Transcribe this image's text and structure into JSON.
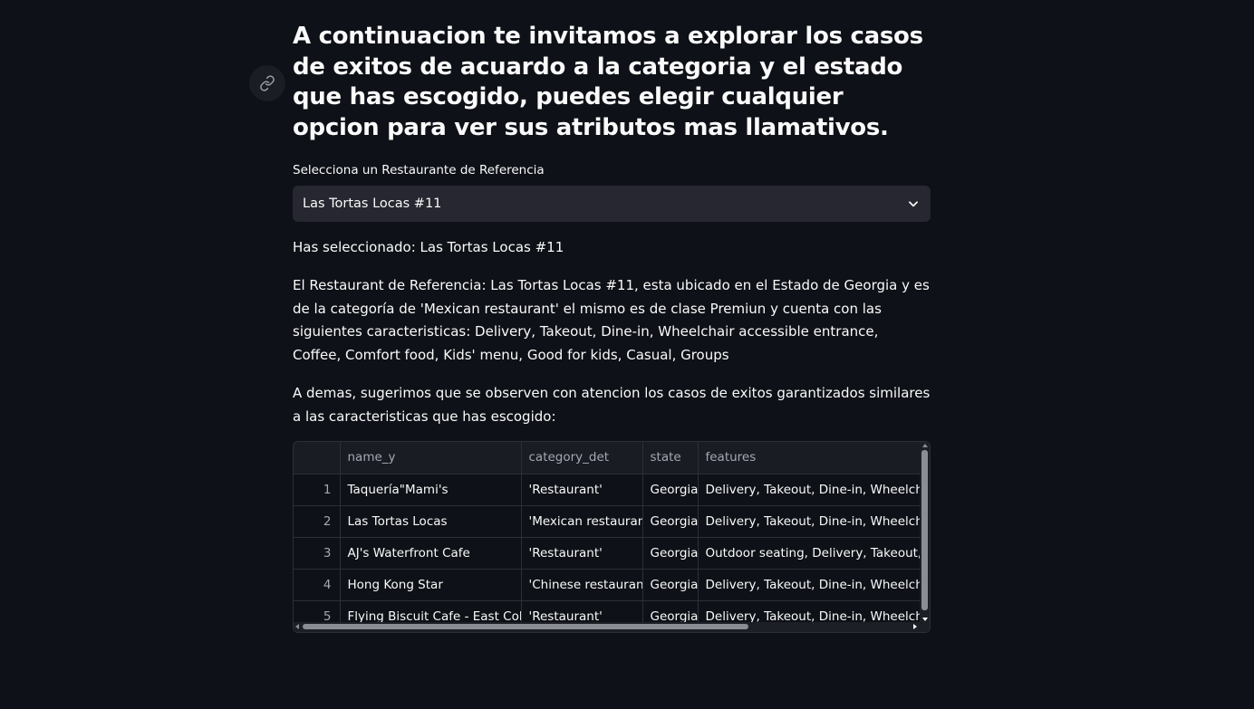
{
  "heading": "A continuacion te invitamos a explorar los casos de exitos de acuardo a la categoria y el estado que has escogido, puedes elegir cualquier opcion para ver sus atributos mas llamativos.",
  "select": {
    "label": "Selecciona un Restaurante de Referencia",
    "value": "Las Tortas Locas #11"
  },
  "selected_text": "Has seleccionado: Las Tortas Locas #11",
  "description": "El Restaurant de Referencia: Las Tortas Locas #11, esta ubicado en el Estado de Georgia y es de la categoría de 'Mexican restaurant' el mismo es de clase Premiun y cuenta con las siguientes caracteristicas: Delivery, Takeout, Dine-in, Wheelchair accessible entrance, Coffee, Comfort food, Kids' menu, Good for kids, Casual, Groups",
  "suggestion": "A demas, sugerimos que se observen con atencion los casos de exitos garantizados similares a las caracteristicas que has escogido:",
  "table": {
    "columns": [
      "",
      "name_y",
      "category_det",
      "state",
      "features"
    ],
    "rows": [
      {
        "index": "1",
        "name_y": "Taquería\"Mami's",
        "category_det": "'Restaurant'",
        "state": "Georgia",
        "features": "Delivery, Takeout, Dine-in, Wheelchair ac"
      },
      {
        "index": "2",
        "name_y": "Las Tortas Locas",
        "category_det": "'Mexican restaurant'",
        "state": "Georgia",
        "features": "Delivery, Takeout, Dine-in, Wheelchair ac"
      },
      {
        "index": "3",
        "name_y": "AJ's Waterfront Cafe",
        "category_det": "'Restaurant'",
        "state": "Georgia",
        "features": "Outdoor seating, Delivery, Takeout, Whee"
      },
      {
        "index": "4",
        "name_y": "Hong Kong Star",
        "category_det": "'Chinese restaurant'",
        "state": "Georgia",
        "features": "Delivery, Takeout, Dine-in, Wheelchair ac"
      },
      {
        "index": "5",
        "name_y": "Flying Biscuit Cafe - East Cobb",
        "category_det": "'Restaurant'",
        "state": "Georgia",
        "features": "Delivery, Takeout, Dine-in, Wheelchair ac"
      }
    ]
  },
  "icons": {
    "anchor": "link-icon",
    "dropdown": "chevron-down-icon"
  },
  "colors": {
    "background": "#0e1117",
    "input_bg": "#262730",
    "text": "#fafafa",
    "muted": "#a3a8b4"
  }
}
